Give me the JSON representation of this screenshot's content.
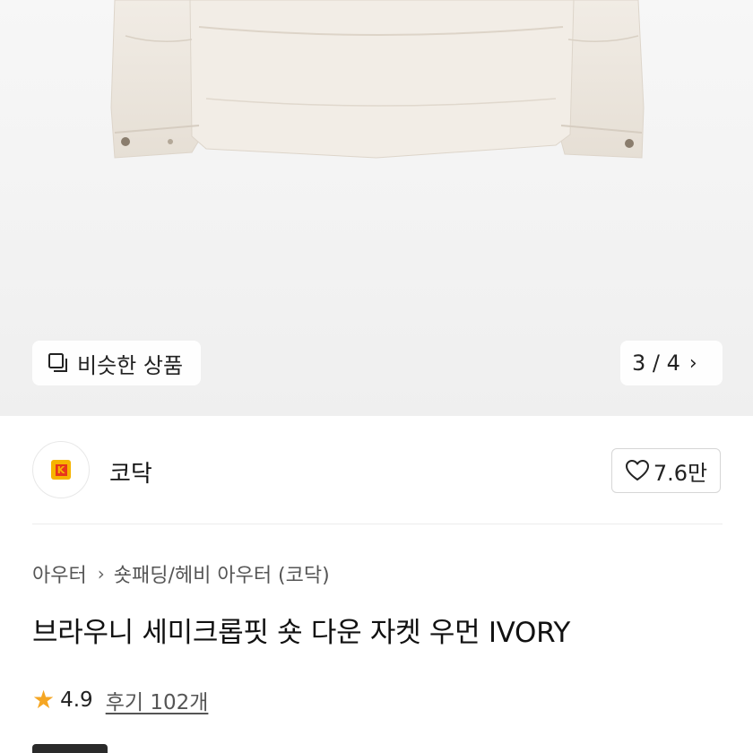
{
  "gallery": {
    "similar_label": "비슷한 상품",
    "pager": "3 / 4",
    "pager_next_icon": "chevron-right-icon"
  },
  "brand": {
    "name": "코닥",
    "logo_letter": "K",
    "like_count": "7.6만",
    "like_icon": "heart-icon"
  },
  "breadcrumb": {
    "items": [
      "아우터",
      "숏패딩/헤비 아우터 (코닥)"
    ],
    "separator_icon": "chevron-right-icon"
  },
  "product": {
    "title": "브라우니 세미크롭핏 숏 다운 자켓 우먼 IVORY",
    "rating": "4.9",
    "reviews": "후기 102개",
    "star_icon": "star-icon"
  },
  "colors": {
    "hero_bg": "#f4f4f4",
    "jacket": "#ece6de",
    "star": "#f5a623",
    "brand_yellow": "#f6b400",
    "brand_red": "#e8351c"
  }
}
